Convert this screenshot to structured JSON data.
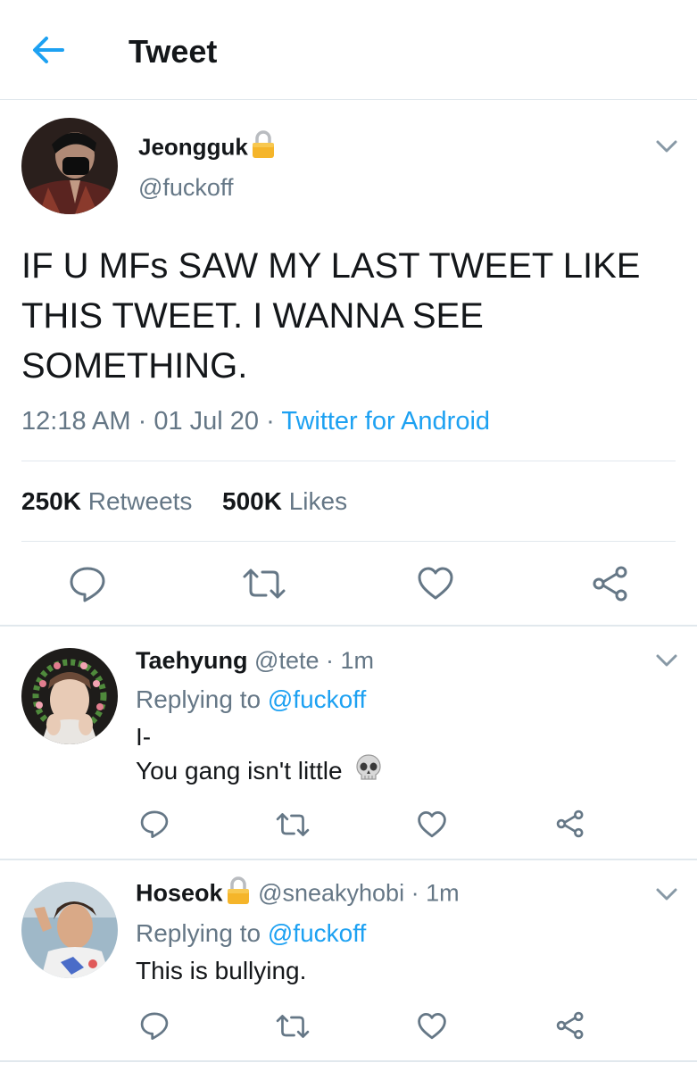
{
  "header": {
    "title": "Tweet"
  },
  "tweet": {
    "author_name": "Jeongguk",
    "author_handle": "@fuckoff",
    "text": "IF U MFs SAW MY LAST TWEET LIKE THIS TWEET. I WANNA SEE SOMETHING.",
    "time": "12:18 AM",
    "date": "01 Jul 20",
    "dot": "·",
    "source": "Twitter for Android",
    "retweets_count": "250K",
    "retweets_label": "Retweets",
    "likes_count": "500K",
    "likes_label": "Likes"
  },
  "replies": [
    {
      "name": "Taehyung",
      "handle": "@tete",
      "time": "· 1m",
      "replying_prefix": "Replying to",
      "replying_to": "@fuckoff",
      "line1": "I-",
      "line2": "You gang isn't little",
      "emoji": "skull-emoji"
    },
    {
      "name": "Hoseok",
      "handle": "@sneakyhobi",
      "time": "· 1m",
      "replying_prefix": "Replying to",
      "replying_to": "@fuckoff",
      "line1": "This is bullying."
    }
  ],
  "icons": [
    "back-arrow-icon",
    "lock-icon",
    "chevron-down-icon",
    "reply-icon",
    "retweet-icon",
    "like-icon",
    "share-icon"
  ],
  "colors": {
    "accent": "#1da1f2",
    "text": "#14171a",
    "muted": "#657786",
    "border": "#e1e8ed"
  }
}
